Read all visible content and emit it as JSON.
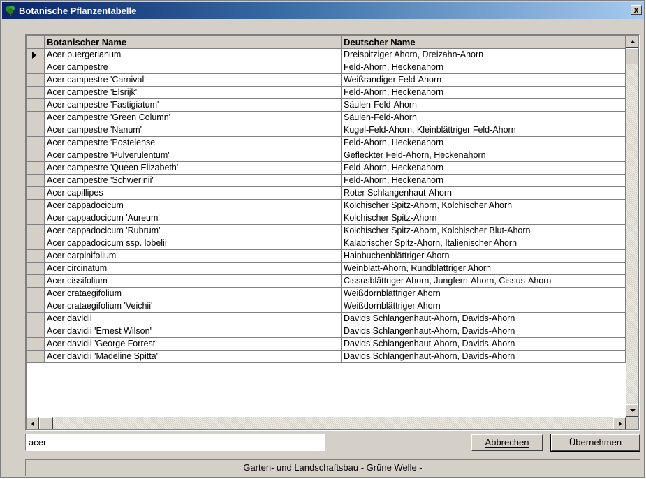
{
  "window": {
    "title": "Botanische Pflanzentabelle",
    "close_label": "x"
  },
  "table": {
    "columns": [
      "Botanischer Name",
      "Deutscher Name"
    ],
    "rows": [
      [
        "Acer buergerianum",
        "Dreispitziger Ahorn, Dreizahn-Ahorn"
      ],
      [
        "Acer campestre",
        "Feld-Ahorn, Heckenahorn"
      ],
      [
        "Acer campestre 'Carnival'",
        "Weißrandiger Feld-Ahorn"
      ],
      [
        "Acer campestre 'Elsrijk'",
        "Feld-Ahorn, Heckenahorn"
      ],
      [
        "Acer campestre 'Fastigiatum'",
        "Säulen-Feld-Ahorn"
      ],
      [
        "Acer campestre 'Green Column'",
        "Säulen-Feld-Ahorn"
      ],
      [
        "Acer campestre 'Nanum'",
        "Kugel-Feld-Ahorn, Kleinblättriger Feld-Ahorn"
      ],
      [
        "Acer campestre 'Postelense'",
        "Feld-Ahorn, Heckenahorn"
      ],
      [
        "Acer campestre 'Pulverulentum'",
        "Gefleckter Feld-Ahorn, Heckenahorn"
      ],
      [
        "Acer campestre 'Queen Elizabeth'",
        "Feld-Ahorn, Heckenahorn"
      ],
      [
        "Acer campestre 'Schwerinii'",
        "Feld-Ahorn, Heckenahorn"
      ],
      [
        "Acer capillipes",
        "Roter Schlangenhaut-Ahorn"
      ],
      [
        "Acer cappadocicum",
        "Kolchischer Spitz-Ahorn, Kolchischer Ahorn"
      ],
      [
        "Acer cappadocicum 'Aureum'",
        "Kolchischer Spitz-Ahorn"
      ],
      [
        "Acer cappadocicum 'Rubrum'",
        "Kolchischer Spitz-Ahorn, Kolchischer Blut-Ahorn"
      ],
      [
        "Acer cappadocicum ssp. lobelii",
        "Kalabrischer Spitz-Ahorn, Italienischer Ahorn"
      ],
      [
        "Acer carpinifolium",
        "Hainbuchenblättriger Ahorn"
      ],
      [
        "Acer circinatum",
        "Weinblatt-Ahorn, Rundblättriger Ahorn"
      ],
      [
        "Acer cissifolium",
        "Cissusblättriger Ahorn, Jungfern-Ahorn, Cissus-Ahorn"
      ],
      [
        "Acer crataegifolium",
        "Weißdornblättriger Ahorn"
      ],
      [
        "Acer crataegifolium 'Veichii'",
        "Weißdornblättriger Ahorn"
      ],
      [
        "Acer davidii",
        "Davids Schlangenhaut-Ahorn, Davids-Ahorn"
      ],
      [
        "Acer davidii 'Ernest Wilson'",
        "Davids Schlangenhaut-Ahorn, Davids-Ahorn"
      ],
      [
        "Acer davidii 'George Forrest'",
        "Davids Schlangenhaut-Ahorn, Davids-Ahorn"
      ],
      [
        "Acer davidii 'Madeline Spitta'",
        "Davids Schlangenhaut-Ahorn, Davids-Ahorn"
      ]
    ]
  },
  "search": {
    "value": "acer"
  },
  "buttons": {
    "cancel": "Abbrechen",
    "ok": "Übernehmen"
  },
  "status": "Garten- und Landschaftsbau  - Grüne Welle -",
  "colors": {
    "title_start": "#0a246a",
    "title_end": "#a6caf0",
    "face": "#d4d0c8"
  }
}
